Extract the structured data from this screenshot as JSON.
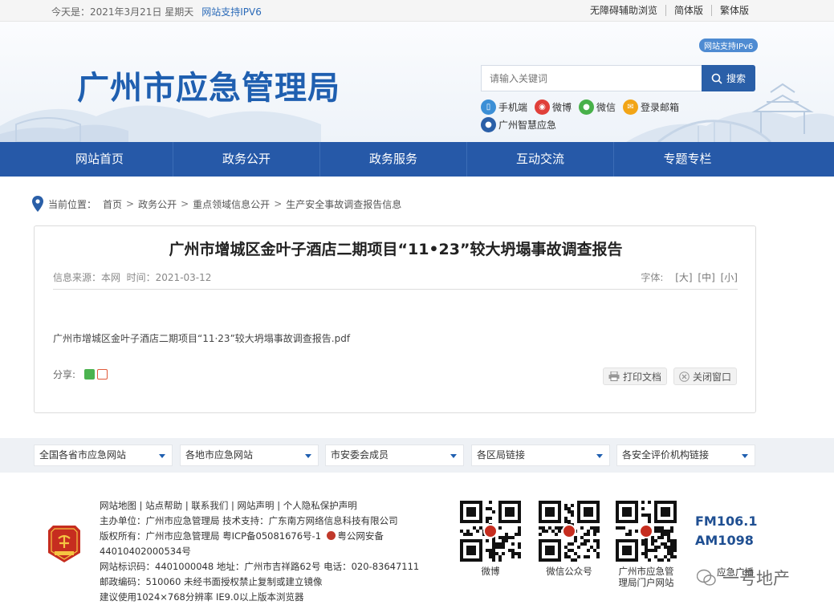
{
  "topbar": {
    "date": "今天是：2021年3月21日 星期天",
    "ipv6": "网站支持IPV6",
    "links": [
      "无障碍辅助浏览",
      "简体版",
      "繁体版"
    ]
  },
  "header": {
    "site_title": "广州市应急管理局",
    "ipv6_badge": "网站支持IPv6",
    "search": {
      "placeholder": "请输入关键词",
      "button": "搜索"
    },
    "quick_links": [
      "手机端",
      "微博",
      "微信",
      "登录邮箱",
      "广州智慧应急"
    ]
  },
  "nav": [
    "网站首页",
    "政务公开",
    "政务服务",
    "互动交流",
    "专题专栏"
  ],
  "breadcrumb": {
    "label": "当前位置：",
    "items": [
      "首页",
      "政务公开",
      "重点领域信息公开",
      "生产安全事故调查报告信息"
    ]
  },
  "article": {
    "title": "广州市增城区金叶子酒店二期项目“11•23”较大坍塌事故调查报告",
    "source": "信息来源：本网",
    "time": "时间：2021-03-12",
    "font_label": "字体:",
    "font_sizes": [
      "[大]",
      "[中]",
      "[小]"
    ],
    "attachment": "广州市增城区金叶子酒店二期项目“11·23”较大坍塌事故调查报告.pdf",
    "share_label": "分享:",
    "print": "打印文档",
    "close": "关闭窗口"
  },
  "link_selects": [
    "全国各省市应急网站",
    "各地市应急网站",
    "市安委会成员",
    "各区局链接",
    "各安全评价机构链接"
  ],
  "footer": {
    "lines": {
      "links": "网站地图 | 站点帮助 | 联系我们 | 网站声明 | 个人隐私保护声明",
      "host": "主办单位：广州市应急管理局  技术支持：广东南方网络信息科技有限公司",
      "copyright": "版权所有：广州市应急管理局  粤ICP备05081676号-1",
      "police": "粤公网安备",
      "police_no": "44010402000534号",
      "site_id": "网站标识码：4401000048  地址：广州市吉祥路62号  电话：020-83647111",
      "postcode": "邮政编码：510060  未经书面授权禁止复制或建立镜像",
      "suggest": "建议使用1024×768分辨率  IE9.0以上版本浏览器"
    },
    "qr": [
      {
        "cap": "微博"
      },
      {
        "cap": "微信公众号"
      },
      {
        "cap": "广州市应急管理局门户网站"
      }
    ],
    "radio": [
      "FM106.1",
      "AM1098"
    ],
    "radio_cap": "应急广播",
    "watermark": "一号地产"
  },
  "colors": {
    "brand": "#1f5fb0",
    "nav": "#2659a8"
  }
}
